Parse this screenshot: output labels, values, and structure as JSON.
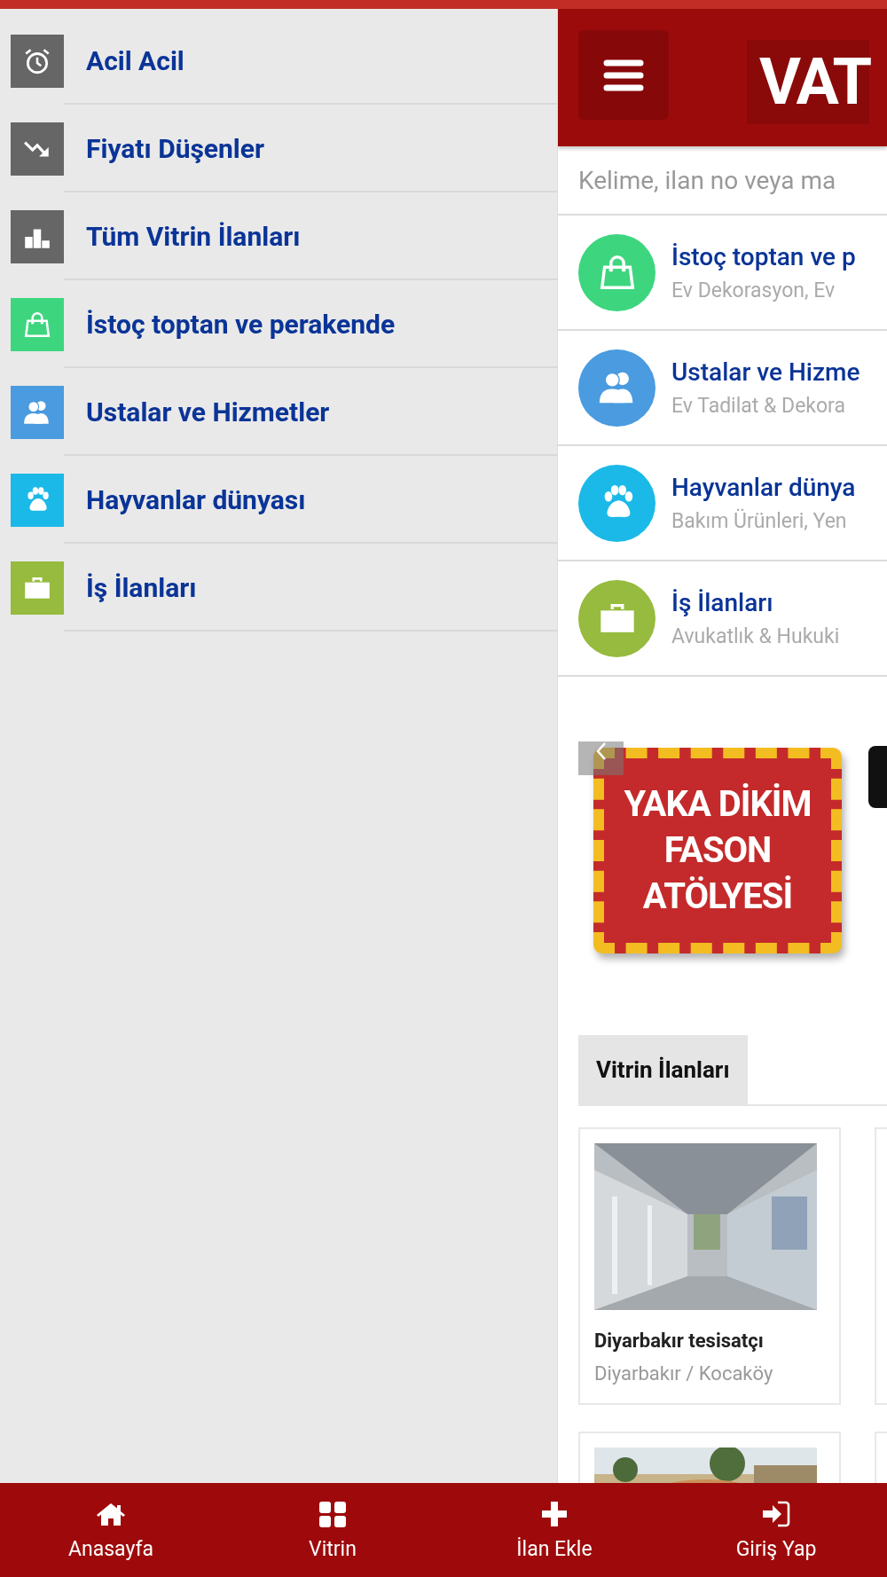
{
  "drawer": {
    "items": [
      {
        "label": "Acil Acil",
        "kind": "alarm",
        "color": "#666666"
      },
      {
        "label": "Fiyatı Düşenler",
        "kind": "trend",
        "color": "#666666"
      },
      {
        "label": "Tüm Vitrin İlanları",
        "kind": "bars",
        "color": "#666666"
      },
      {
        "label": "İstoç toptan ve perakende",
        "kind": "bag",
        "color": "#3dd67f"
      },
      {
        "label": "Ustalar ve Hizmetler",
        "kind": "people",
        "color": "#4a9be0"
      },
      {
        "label": "Hayvanlar dünyası",
        "kind": "paw",
        "color": "#1bb9e8"
      },
      {
        "label": "İş İlanları",
        "kind": "briefcase",
        "color": "#96bb3e"
      }
    ]
  },
  "header": {
    "logo": "VAT"
  },
  "search": {
    "placeholder": "Kelime, ilan no veya ma"
  },
  "categories": [
    {
      "title": "İstoç toptan ve p",
      "subtitle": "Ev Dekorasyon, Ev",
      "kind": "bag",
      "color": "#3dd67f"
    },
    {
      "title": "Ustalar ve Hizme",
      "subtitle": "Ev Tadilat & Dekora",
      "kind": "people",
      "color": "#4a9be0"
    },
    {
      "title": "Hayvanlar dünya",
      "subtitle": "Bakım Ürünleri, Yen",
      "kind": "paw",
      "color": "#1bb9e8"
    },
    {
      "title": "İş İlanları",
      "subtitle": "Avukatlık & Hukuki",
      "kind": "briefcase",
      "color": "#96bb3e"
    }
  ],
  "banner": {
    "lines": [
      "YAKA DİKİM",
      "FASON",
      "ATÖLYESİ"
    ]
  },
  "section_tab": {
    "label": "Vitrin İlanları"
  },
  "listings": [
    {
      "kind": "listing",
      "title": "Diyarbakır tesisatçı",
      "location": "Diyarbakır / Kocaköy"
    },
    {
      "kind": "picture"
    }
  ],
  "bottom_nav": [
    {
      "label": "Anasayfa",
      "kind": "home"
    },
    {
      "label": "Vitrin",
      "kind": "grid"
    },
    {
      "label": "İlan Ekle",
      "kind": "plus"
    },
    {
      "label": "Giriş Yap",
      "kind": "signin"
    }
  ]
}
